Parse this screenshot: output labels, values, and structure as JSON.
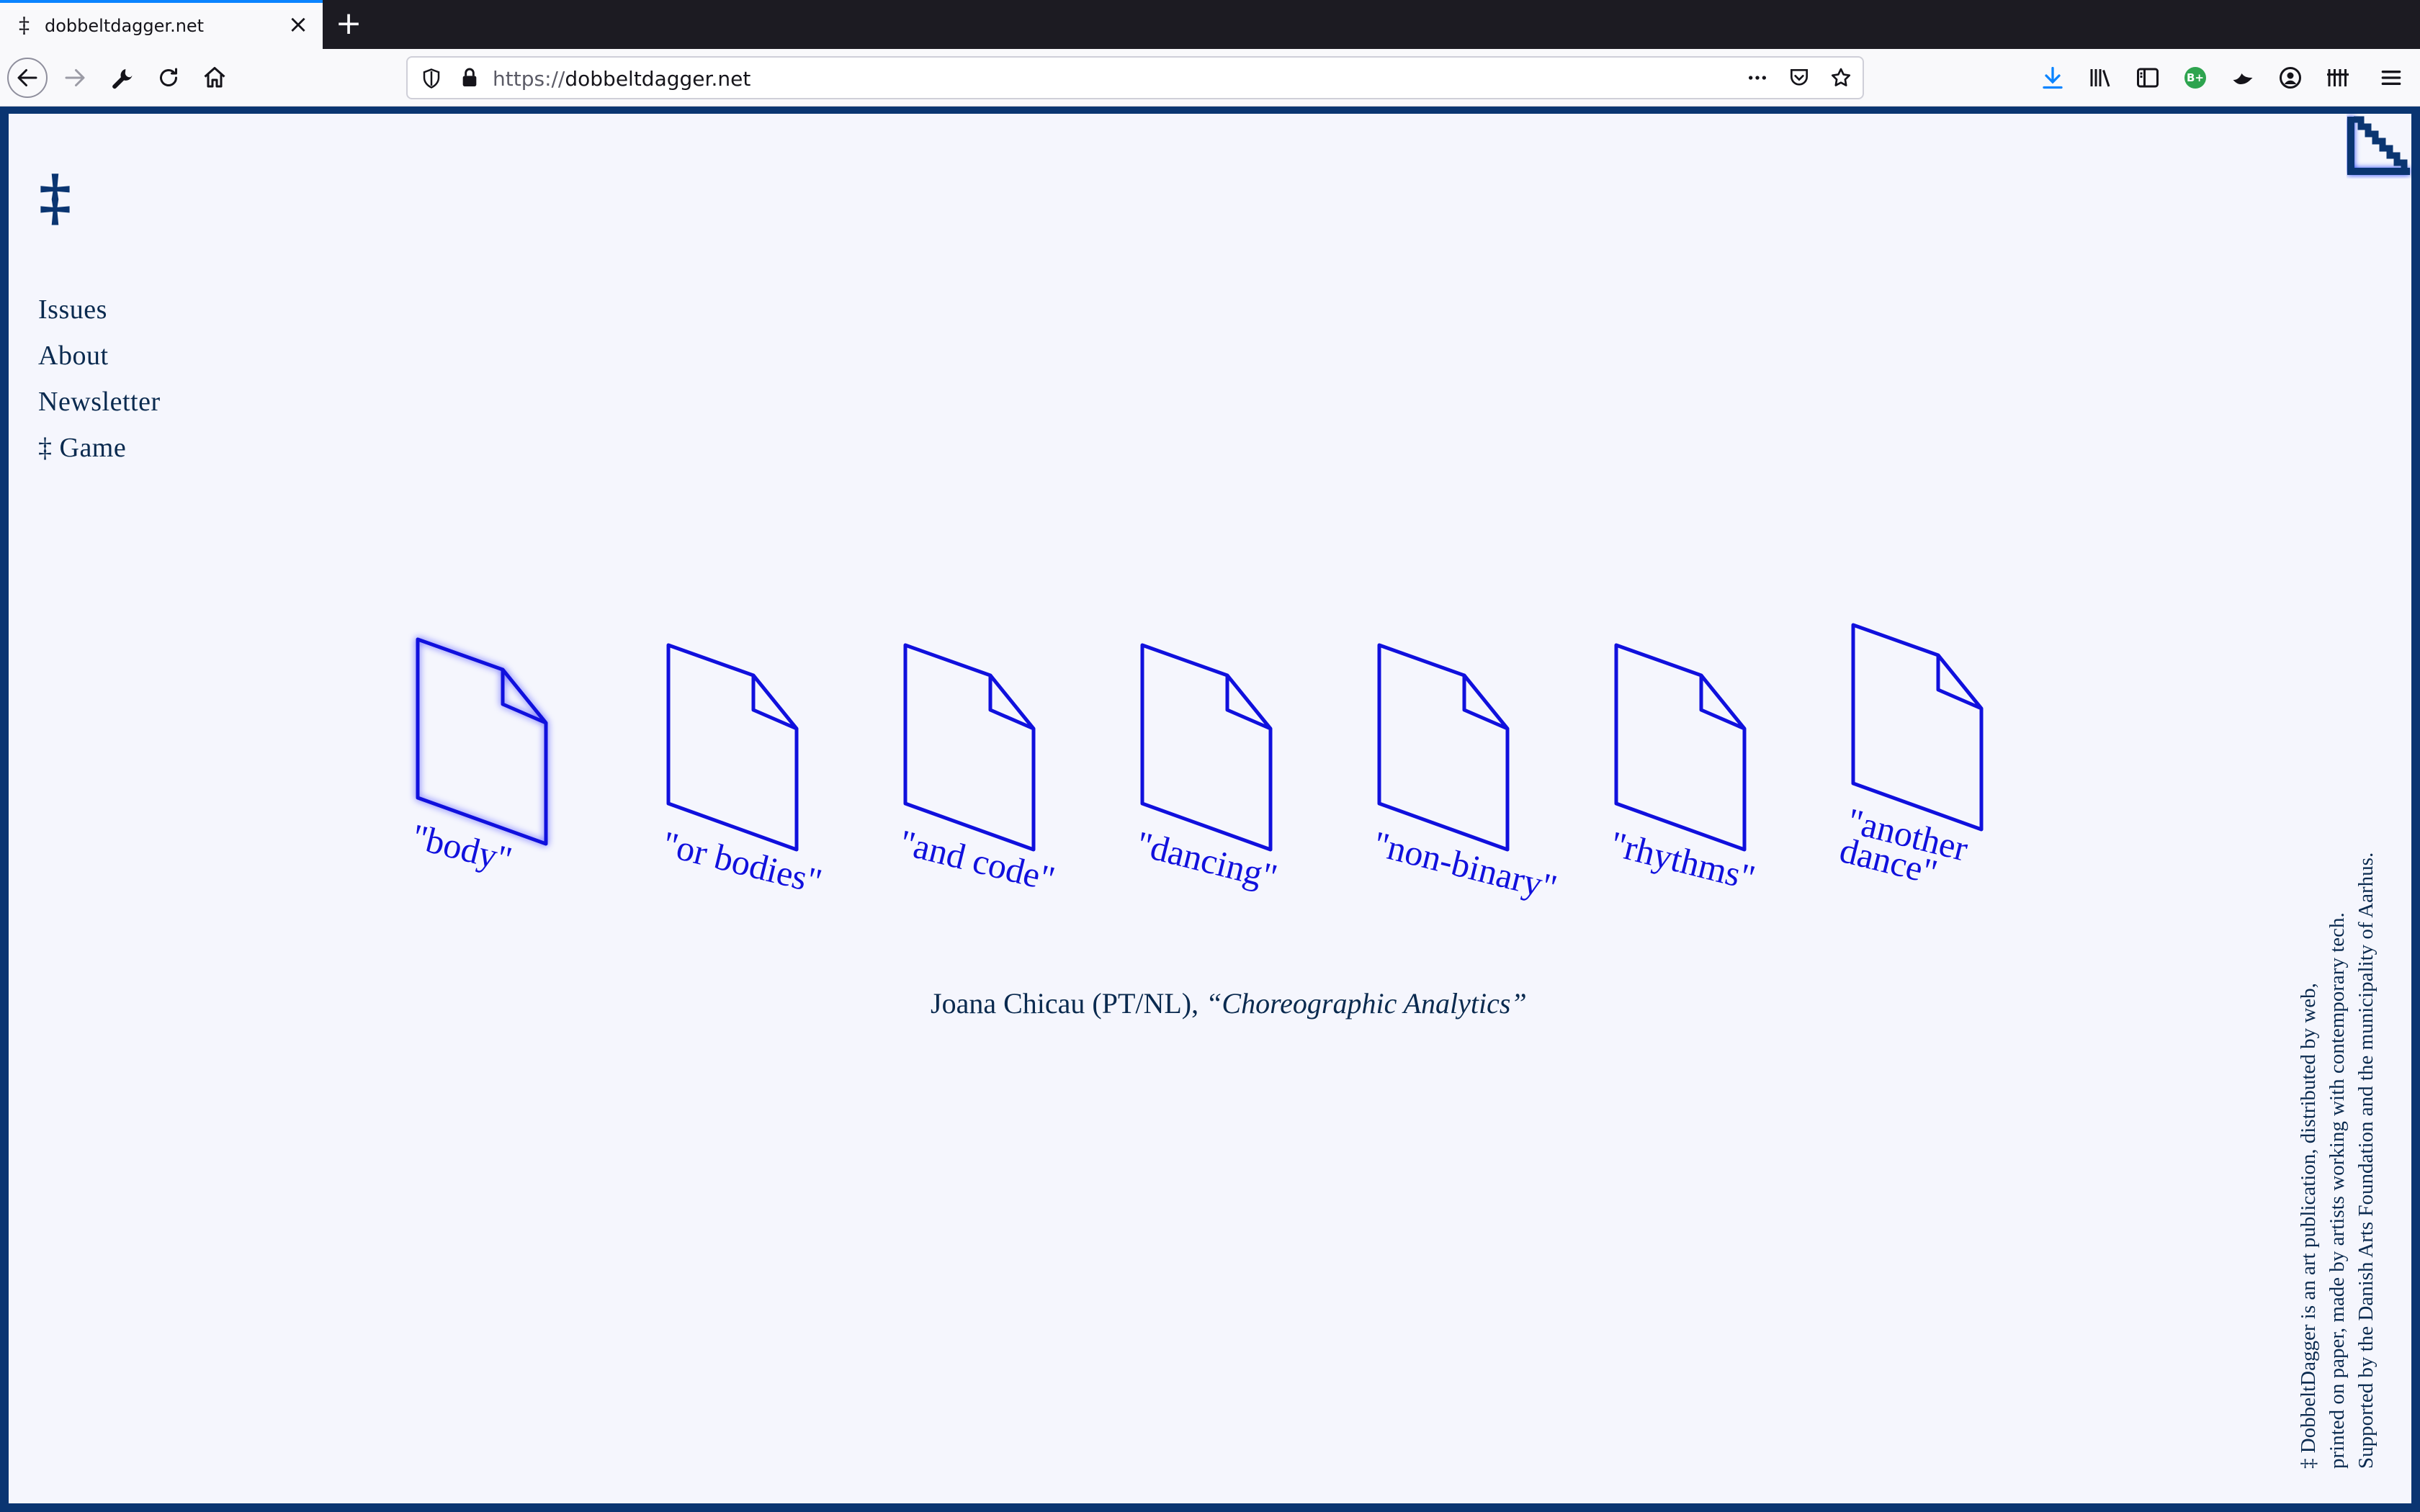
{
  "browser": {
    "tab_favicon": "‡",
    "tab_title": "dobbeltdagger.net",
    "tab_close": "×",
    "new_tab": "+",
    "url_protocol": "https://",
    "url_host": "dobbeltdagger.net",
    "extension_badge": "B+",
    "menu_icon": "hamburger-icon"
  },
  "site": {
    "logo": "‡",
    "nav": [
      "Issues",
      "About",
      "Newsletter",
      "‡ Game"
    ],
    "words": [
      "\"body\"",
      "\"or bodies\"",
      "\"and code\"",
      "\"dancing\"",
      "\"non-binary\"",
      "\"rhythms\"",
      "\"another\ndance\""
    ],
    "credit_author": "Joana Chicau (PT/NL), ",
    "credit_title": "“Choreographic Analytics”",
    "footer_lines": [
      "‡ DobbeltDagger is an art publication, distributed by web,",
      "printed on paper, made by artists working with contemporary tech.",
      "Supported by the Danish Arts Foundation and the municipality of Aarhus."
    ]
  },
  "colors": {
    "frame": "#0a3571",
    "accent_blue": "#1010dd",
    "background": "#f5f6fd"
  }
}
